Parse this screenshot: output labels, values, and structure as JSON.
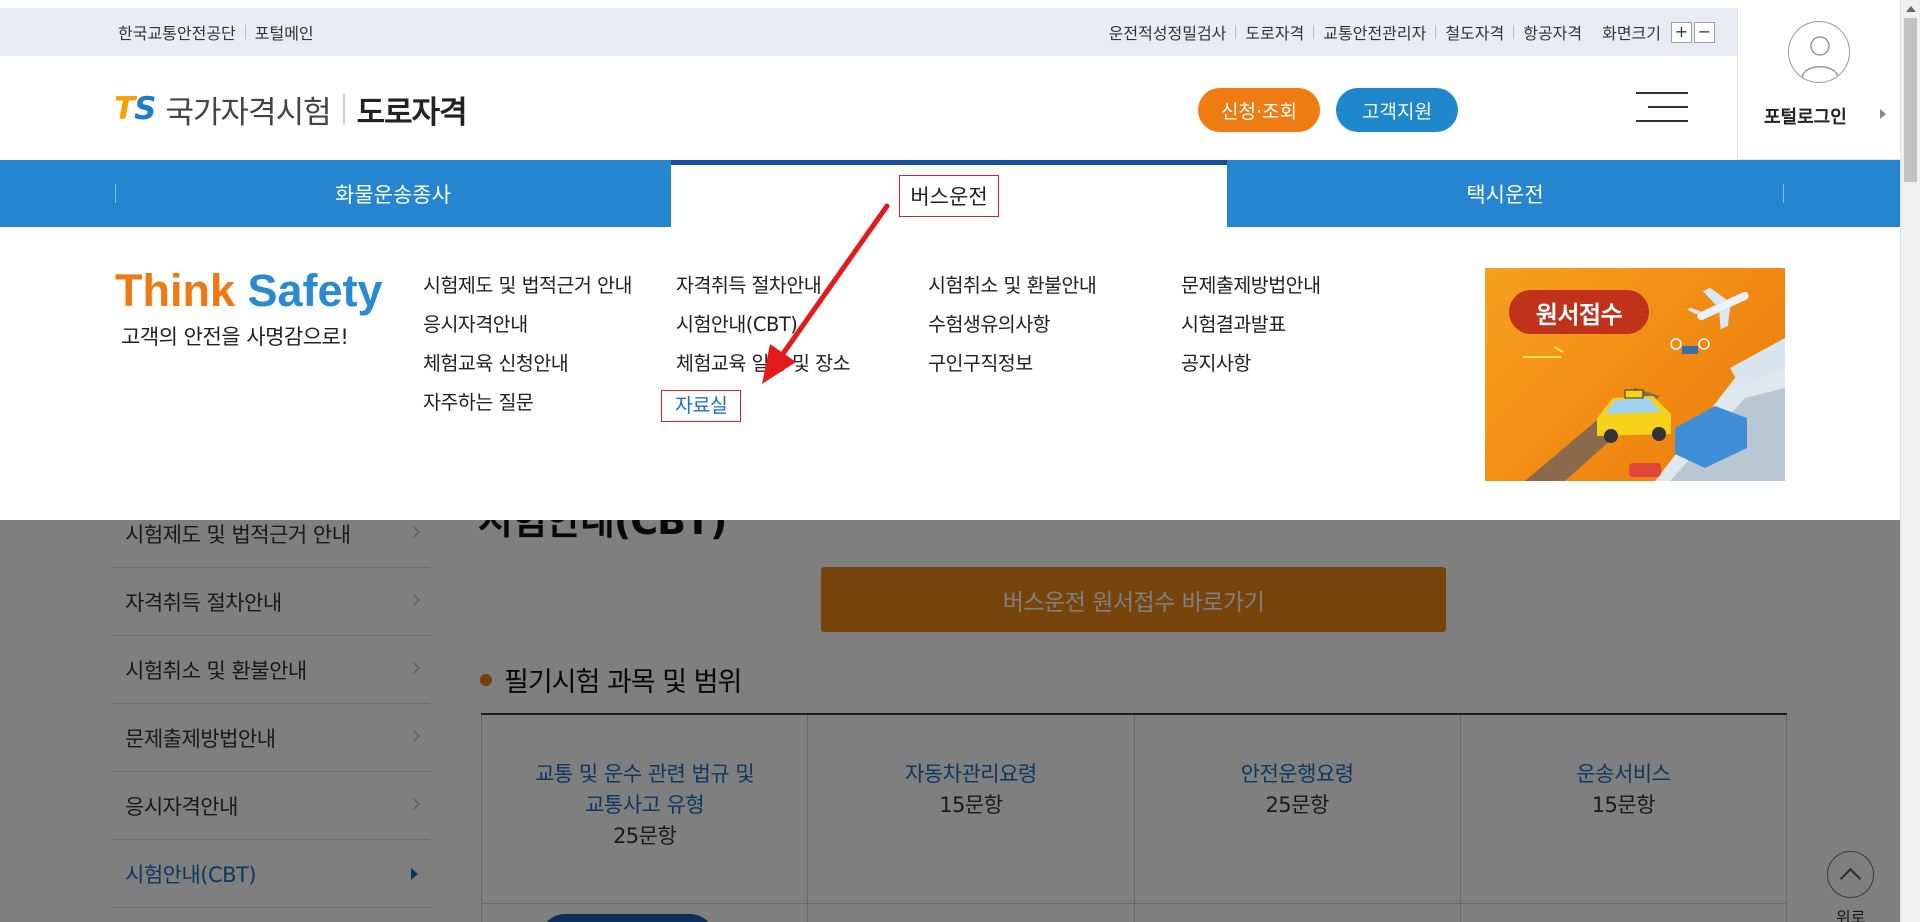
{
  "topbar": {
    "left_links": [
      "한국교통안전공단",
      "포털메인"
    ],
    "right_links": [
      "운전적성정밀검사",
      "도로자격",
      "교통안전관리자",
      "철도자격",
      "항공자격"
    ],
    "zoom_label": "화면크기",
    "zoom_in": "+",
    "zoom_out": "−"
  },
  "header": {
    "logo_ts": [
      "T",
      "S"
    ],
    "logo_exam": "국가자격시험",
    "logo_section": "도로자격",
    "btn_apply": "신청·조회",
    "btn_support": "고객지원",
    "login_label": "포털로그인"
  },
  "nav": {
    "items": [
      "화물운송종사",
      "버스운전",
      "택시운전"
    ],
    "active_index": 1
  },
  "mega": {
    "slogan_a": "Think",
    "slogan_b": "Safety",
    "slogan_sub": "고객의 안전을 사명감으로!",
    "col1": [
      "시험제도 및 법적근거 안내",
      "응시자격안내",
      "체험교육 신청안내",
      "자주하는 질문"
    ],
    "col2": [
      "자격취득 절차안내",
      "시험안내(CBT)",
      "체험교육 일정 및 장소",
      "자료실"
    ],
    "col3": [
      "시험취소 및 환불안내",
      "수험생유의사항",
      "구인구직정보"
    ],
    "col4": [
      "문제출제방법안내",
      "시험결과발표",
      "공지사항"
    ],
    "banner_label": "원서접수"
  },
  "sidebar": {
    "items": [
      "시험제도 및 법적근거 안내",
      "자격취득 절차안내",
      "시험취소 및 환불안내",
      "문제출제방법안내",
      "응시자격안내",
      "시험안내(CBT)"
    ],
    "active_index": 5
  },
  "content": {
    "page_title": "시험안내(CBT)",
    "apply_button": "버스운전 원서접수 바로가기",
    "section_title": "필기시험 과목 및 범위",
    "table": [
      {
        "subject": "교통 및 운수 관련 법규 및 교통사고 유형",
        "count": "25문항"
      },
      {
        "subject": "자동차관리요령",
        "count": "15문항"
      },
      {
        "subject": "안전운행요령",
        "count": "25문항"
      },
      {
        "subject": "운송서비스",
        "count": "15문항"
      }
    ],
    "top_label": "위로"
  },
  "colors": {
    "nav_blue": "#2586cf",
    "accent_orange": "#ee7c12",
    "link_blue": "#1a6fc0",
    "highlight_red": "#e02020"
  }
}
